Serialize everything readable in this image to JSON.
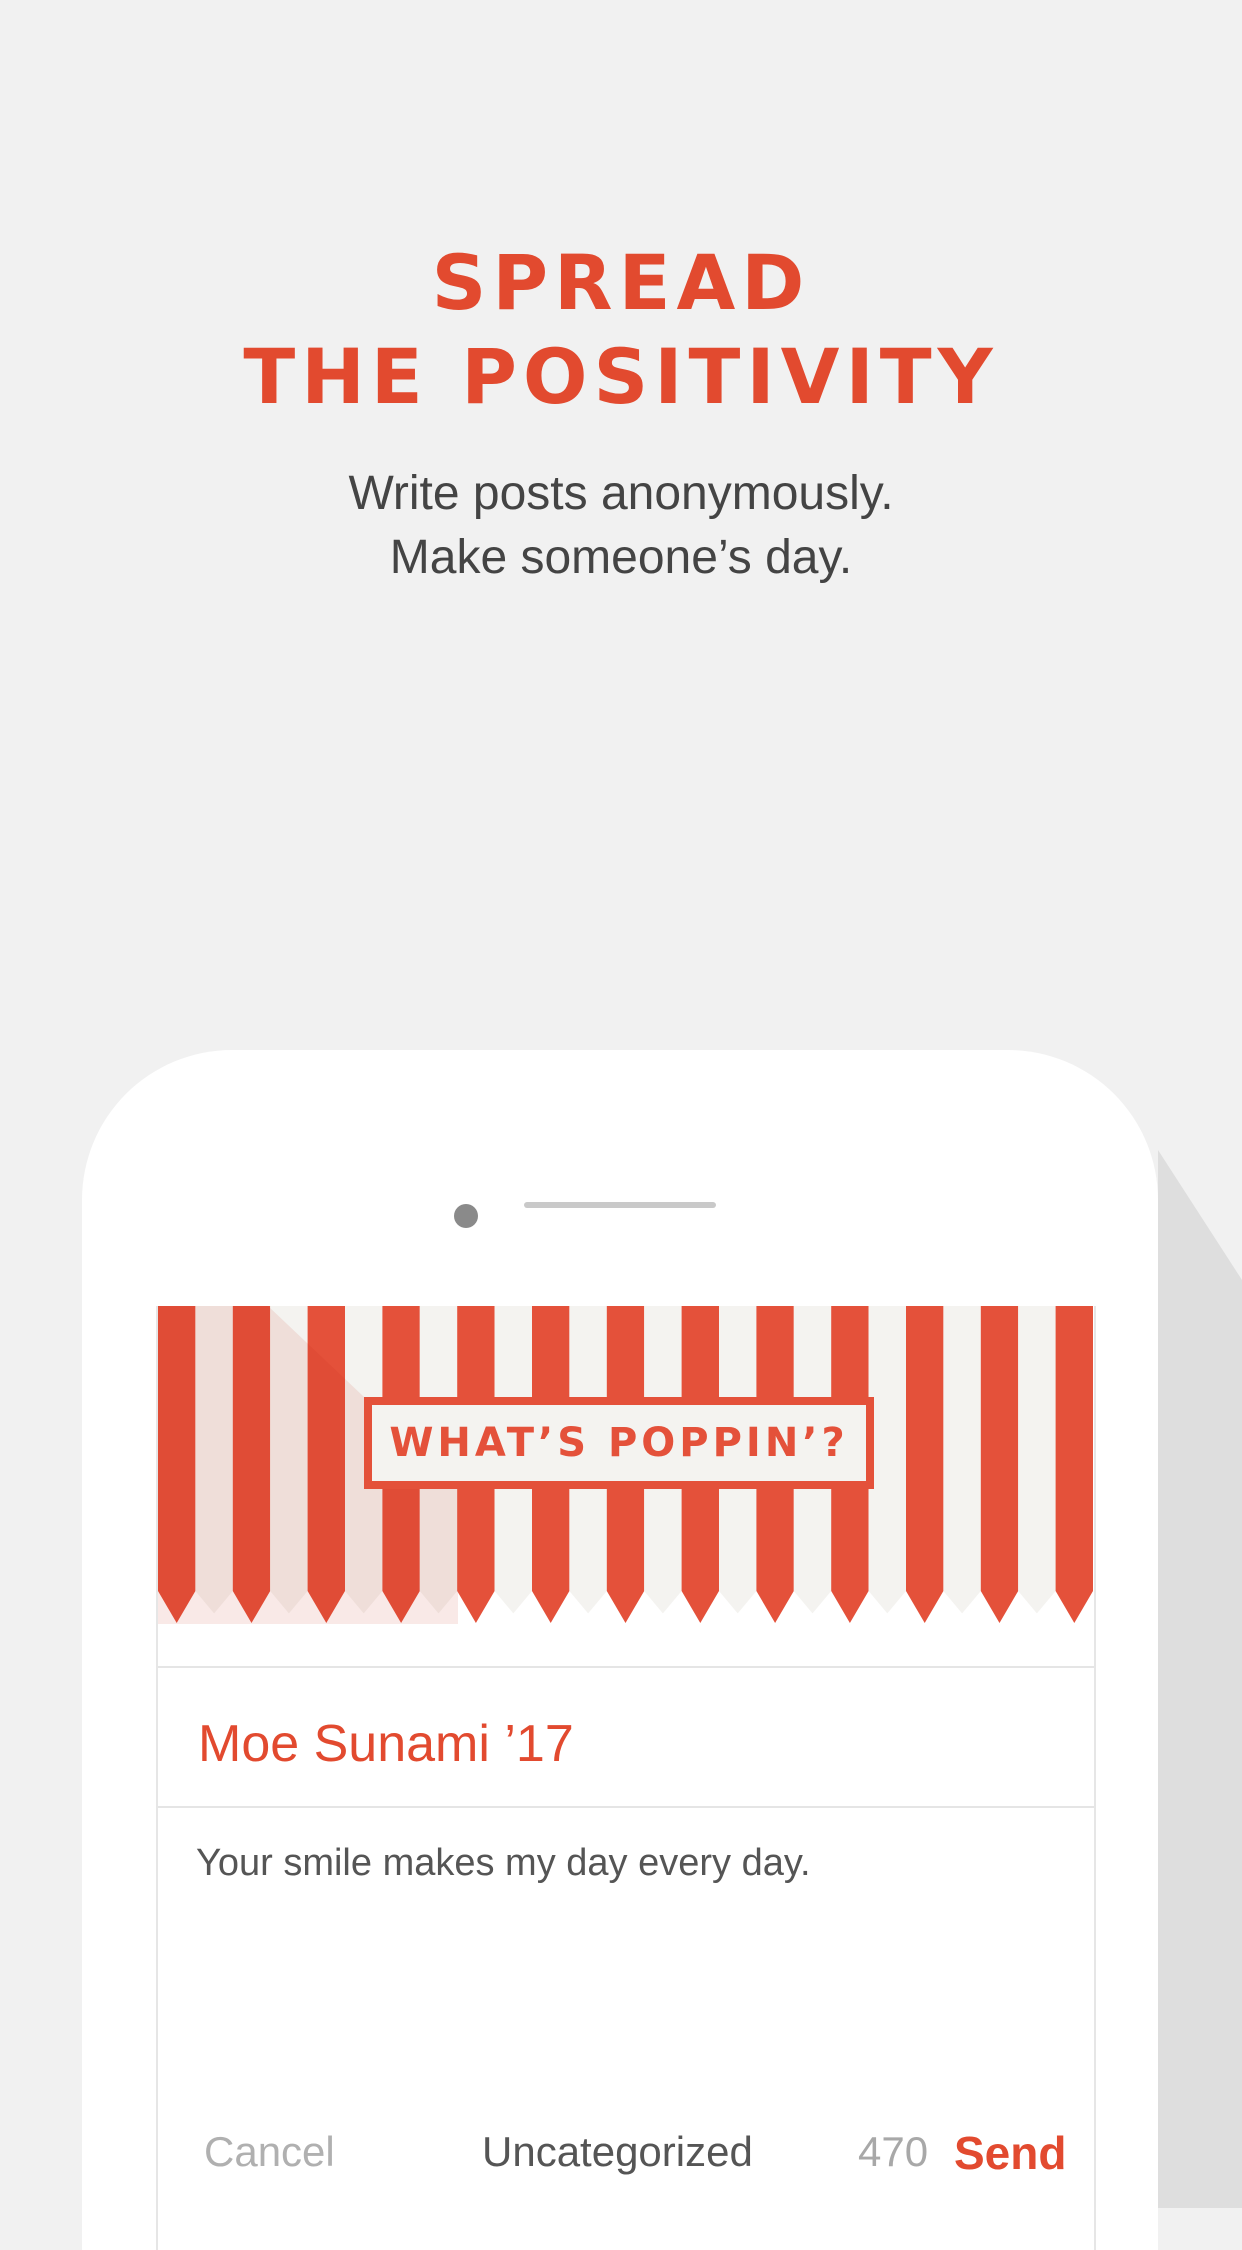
{
  "hero": {
    "title_line1": "SPREAD",
    "title_line2": "THE POSITIVITY",
    "subtitle_line1": "Write posts anonymously.",
    "subtitle_line2": "Make someone’s day."
  },
  "compose": {
    "banner_label": "WHAT’S POPPIN’?",
    "recipient": "Moe Sunami ’17",
    "message": "Your smile makes my day every day.",
    "cancel_label": "Cancel",
    "category_label": "Uncategorized",
    "char_count": "470",
    "send_label": "Send"
  },
  "colors": {
    "accent": "#e24a2f",
    "stripe": "#e4513a",
    "background": "#f1f1f1"
  }
}
